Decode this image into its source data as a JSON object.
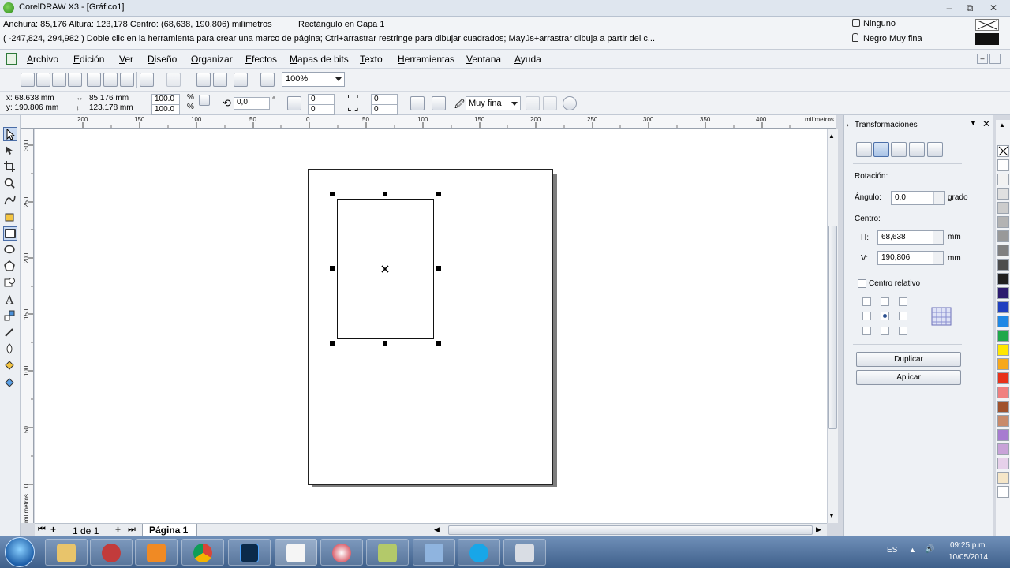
{
  "window": {
    "title": "CorelDRAW X3 - [Gráfico1]",
    "controls": {
      "minimize": "–",
      "restore": "⧉",
      "close": "✕"
    }
  },
  "info_bar": {
    "dimensions": "Anchura: 85,176  Altura: 123,178  Centro: (68,638, 190,806)  milímetros",
    "layer_text": "Rectángulo en Capa 1",
    "hint": "( -247,824, 294,982 )  Doble clic en la herramienta para crear una marco de página; Ctrl+arrastrar restringe para dibujar cuadrados; Mayús+arrastrar dibuja a partir del c...",
    "fill_label": "Ninguno",
    "outline_label": "Negro Muy fina",
    "outline_color": "#111111"
  },
  "menu": {
    "items": [
      "Archivo",
      "Edición",
      "Ver",
      "Diseño",
      "Organizar",
      "Efectos",
      "Mapas de bits",
      "Texto",
      "Herramientas",
      "Ventana",
      "Ayuda"
    ]
  },
  "toolbar": {
    "zoom": "100%"
  },
  "property_bar": {
    "x": "x:  68.638 mm",
    "y": "y: 190.806 mm",
    "width": "85.176 mm",
    "height": "123.178 mm",
    "scale_w": "100.0",
    "scale_h": "100.0",
    "percent": "%",
    "rotation": "0,0",
    "degree": "°",
    "corner_1": "0",
    "corner_2": "0",
    "corner_3": "0",
    "corner_4": "0",
    "outline_width": "Muy fina"
  },
  "ruler": {
    "unit": "milímetros",
    "h_labels": [
      "200",
      "150",
      "100",
      "50",
      "0",
      "50",
      "100",
      "150",
      "200",
      "250",
      "300",
      "350",
      "400"
    ],
    "v_labels": [
      "300",
      "250",
      "200",
      "150",
      "100",
      "50",
      "0"
    ]
  },
  "page_nav": {
    "count": "1 de 1",
    "tab": "Página 1"
  },
  "docker": {
    "title": "Transformaciones",
    "rotation_label": "Rotación:",
    "angle_label": "Ángulo:",
    "angle_value": "0,0",
    "angle_unit": "grado",
    "center_label": "Centro:",
    "h_label": "H:",
    "h_value": "68,638",
    "h_unit": "mm",
    "v_label": "V:",
    "v_value": "190,806",
    "v_unit": "mm",
    "relative_center": "Centro relativo",
    "duplicate": "Duplicar",
    "apply": "Aplicar"
  },
  "palette": [
    "#ffffff",
    "#f2f2f2",
    "#e0e0e0",
    "#cccccc",
    "#b3b3b3",
    "#999999",
    "#808080",
    "#4d4d4d",
    "#1f1f1f",
    "#2b1a6e",
    "#1f3fbf",
    "#1e88e5",
    "#1fa84a",
    "#ffe600",
    "#f7a81b",
    "#e8311a",
    "#f08080",
    "#a0522d",
    "#c88a6a",
    "#a77bd0",
    "#c8a2d8",
    "#e6d0ea",
    "#f5e6c8",
    "#ffffff"
  ],
  "taskbar": {
    "lang": "ES",
    "time": "09:25 p.m.",
    "date": "10/05/2014"
  }
}
